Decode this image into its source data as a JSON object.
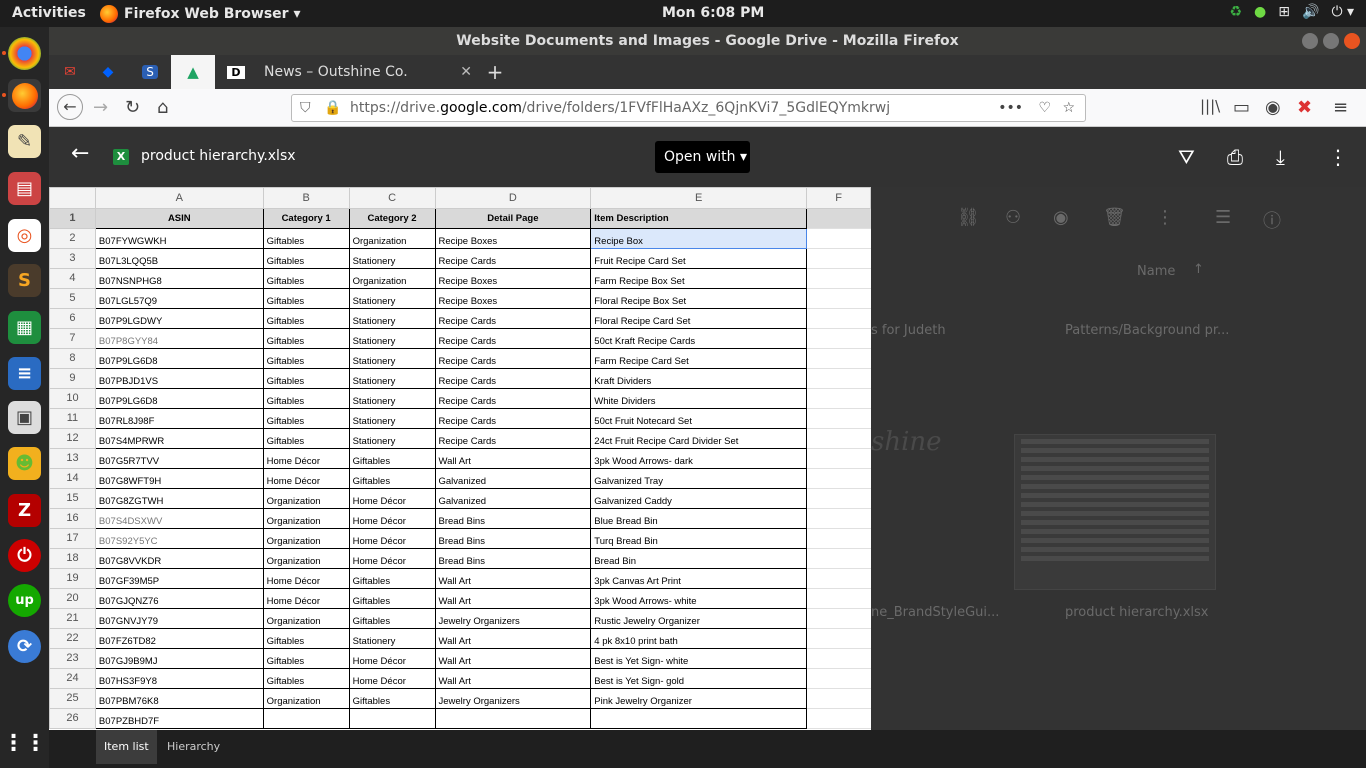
{
  "topbar": {
    "activities": "Activities",
    "app_menu": "Firefox Web Browser ▾",
    "clock": "Mon  6:08 PM"
  },
  "window": {
    "title": "Website Documents and Images - Google Drive - Mozilla Firefox",
    "news_tab": "News – Outshine Co.",
    "url_prefix": "https://drive.",
    "url_domain": "google.com",
    "url_path": "/drive/folders/1FVfFlHaAXz_6QjnKVi7_5GdlEQYmkrwj"
  },
  "viewer": {
    "file_name": "product hierarchy.xlsx",
    "open_with": "Open with"
  },
  "background": {
    "name_col": "Name",
    "file1": "s for Judeth",
    "file2": "Patterns/Background pr...",
    "file3": "ne_BrandStyleGui...",
    "file4": "product hierarchy.xlsx",
    "logo_text": "shine"
  },
  "sheet": {
    "columns": [
      "A",
      "B",
      "C",
      "D",
      "E",
      "F"
    ],
    "header": [
      "ASIN",
      "Category 1",
      "Category 2",
      "Detail Page",
      "Item Description"
    ],
    "rows": [
      [
        "B07FYWGWKH",
        "Giftables",
        "Organization",
        "Recipe Boxes",
        "Recipe Box"
      ],
      [
        "B07L3LQQ5B",
        "Giftables",
        "Stationery",
        "Recipe Cards",
        "Fruit Recipe Card Set"
      ],
      [
        "B07NSNPHG8",
        "Giftables",
        "Organization",
        "Recipe Boxes",
        "Farm Recipe Box Set"
      ],
      [
        "B07LGL57Q9",
        "Giftables",
        "Stationery",
        "Recipe Boxes",
        "Floral Recipe Box Set"
      ],
      [
        "B07P9LGDWY",
        "Giftables",
        "Stationery",
        "Recipe Cards",
        "Floral Recipe Card Set"
      ],
      [
        "B07P8GYY84",
        "Giftables",
        "Stationery",
        "Recipe Cards",
        "50ct Kraft Recipe Cards"
      ],
      [
        "B07P9LG6D8",
        "Giftables",
        "Stationery",
        "Recipe Cards",
        "Farm Recipe Card Set"
      ],
      [
        "B07PBJD1VS",
        "Giftables",
        "Stationery",
        "Recipe Cards",
        "Kraft Dividers"
      ],
      [
        "B07P9LG6D8",
        "Giftables",
        "Stationery",
        "Recipe Cards",
        "White Dividers"
      ],
      [
        "B07RL8J98F",
        "Giftables",
        "Stationery",
        "Recipe Cards",
        "50ct Fruit Notecard Set"
      ],
      [
        "B07S4MPRWR",
        "Giftables",
        "Stationery",
        "Recipe Cards",
        "24ct Fruit Recipe Card Divider Set"
      ],
      [
        "B07G5R7TVV",
        "Home Décor",
        "Giftables",
        "Wall Art",
        "3pk Wood Arrows- dark"
      ],
      [
        "B07G8WFT9H",
        "Home Décor",
        "Giftables",
        "Galvanized",
        "Galvanized Tray"
      ],
      [
        "B07G8ZGTWH",
        "Organization",
        "Home Décor",
        "Galvanized",
        "Galvanized Caddy"
      ],
      [
        "B07S4DSXWV",
        "Organization",
        "Home Décor",
        "Bread Bins",
        "Blue Bread Bin"
      ],
      [
        "B07S92Y5YC",
        "Organization",
        "Home Décor",
        "Bread Bins",
        "Turq Bread Bin"
      ],
      [
        "B07G8VVKDR",
        "Organization",
        "Home Décor",
        "Bread Bins",
        "Bread Bin"
      ],
      [
        "B07GF39M5P",
        "Home Décor",
        "Giftables",
        "Wall Art",
        "3pk Canvas Art Print"
      ],
      [
        "B07GJQNZ76",
        "Home Décor",
        "Giftables",
        "Wall Art",
        "3pk Wood Arrows- white"
      ],
      [
        "B07GNVJY79",
        "Organization",
        "Giftables",
        "Jewelry Organizers",
        "Rustic Jewelry Organizer"
      ],
      [
        "B07FZ6TD82",
        "Giftables",
        "Stationery",
        "Wall Art",
        "4 pk 8x10 print bath"
      ],
      [
        "B07GJ9B9MJ",
        "Giftables",
        "Home Décor",
        "Wall Art",
        "Best is Yet Sign- white"
      ],
      [
        "B07HS3F9Y8",
        "Giftables",
        "Home Décor",
        "Wall Art",
        "Best is Yet Sign- gold"
      ],
      [
        "B07PBM76K8",
        "Organization",
        "Giftables",
        "Jewelry Organizers",
        "Pink Jewelry Organizer"
      ],
      [
        "B07PZBHD7F",
        "",
        "",
        "",
        ""
      ]
    ]
  },
  "sheet_tabs": [
    "Item list",
    "Hierarchy"
  ]
}
